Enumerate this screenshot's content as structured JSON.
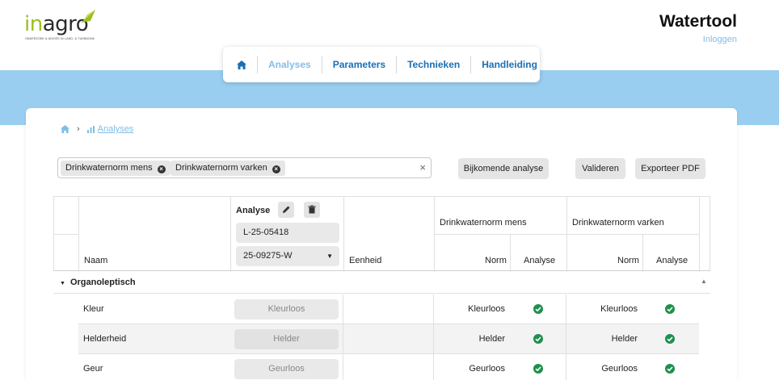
{
  "header": {
    "logo_text_i": "in",
    "logo_text_rest": "agro",
    "logo_sub": "ONDERZOEK & ADVIES IN LAND- & TUINBOUW",
    "app_title": "Watertool",
    "login_label": "Inloggen"
  },
  "nav": {
    "items": [
      {
        "label": "Analyses"
      },
      {
        "label": "Parameters"
      },
      {
        "label": "Technieken"
      },
      {
        "label": "Handleiding"
      }
    ]
  },
  "breadcrumb": {
    "current": "Analyses"
  },
  "filters": {
    "tags": [
      "Drinkwaternorm mens",
      "Drinkwaternorm varken"
    ]
  },
  "actions": {
    "extra_analysis": "Bijkomende analyse",
    "validate": "Valideren",
    "export_pdf": "Exporteer PDF"
  },
  "table": {
    "col_name": "Naam",
    "col_analysis": "Analyse",
    "analysis_id": "L-25-05418",
    "sample_select": "25-09275-W",
    "col_unit": "Eenheid",
    "norm_groups": [
      "Drinkwaternorm mens",
      "Drinkwaternorm varken"
    ],
    "sub_norm": "Norm",
    "sub_analysis": "Analyse",
    "group_label": "Organoleptisch",
    "rows": [
      {
        "name": "Kleur",
        "value": "Kleurloos",
        "norm_mens": "Kleurloos",
        "norm_varken": "Kleurloos"
      },
      {
        "name": "Helderheid",
        "value": "Helder",
        "norm_mens": "Helder",
        "norm_varken": "Helder"
      },
      {
        "name": "Geur",
        "value": "Geurloos",
        "norm_mens": "Geurloos",
        "norm_varken": "Geurloos"
      }
    ]
  },
  "colors": {
    "accent": "#1a6fb5",
    "band": "#99cef0",
    "check": "#1f8f4e"
  }
}
